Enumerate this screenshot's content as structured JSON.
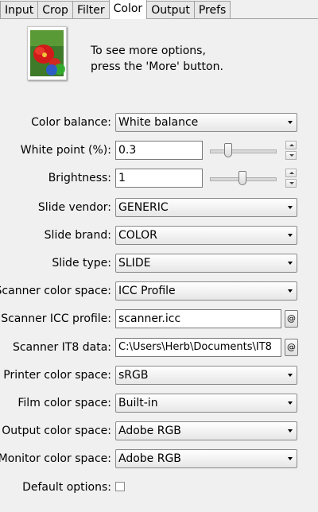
{
  "tabs": [
    "Input",
    "Crop",
    "Filter",
    "Color",
    "Output",
    "Prefs"
  ],
  "active_tab": "Color",
  "info": {
    "line1": "To see more options,",
    "line2": "press the 'More' button."
  },
  "fields": {
    "color_balance": {
      "label": "Color balance:",
      "value": "White balance"
    },
    "white_point": {
      "label": "White point (%):",
      "value": "0.3",
      "slider_fraction": 0.25
    },
    "brightness": {
      "label": "Brightness:",
      "value": "1",
      "slider_fraction": 0.5
    },
    "slide_vendor": {
      "label": "Slide vendor:",
      "value": "GENERIC"
    },
    "slide_brand": {
      "label": "Slide brand:",
      "value": "COLOR"
    },
    "slide_type": {
      "label": "Slide type:",
      "value": "SLIDE"
    },
    "scanner_color_space": {
      "label": "Scanner color space:",
      "value": "ICC Profile"
    },
    "scanner_icc_profile": {
      "label": "Scanner ICC profile:",
      "value": "scanner.icc",
      "button": "@"
    },
    "scanner_it8_data": {
      "label": "Scanner IT8 data:",
      "value": "C:\\Users\\Herb\\Documents\\IT8",
      "button": "@"
    },
    "printer_color_space": {
      "label": "Printer color space:",
      "value": "sRGB"
    },
    "film_color_space": {
      "label": "Film color space:",
      "value": "Built-in"
    },
    "output_color_space": {
      "label": "Output color space:",
      "value": "Adobe RGB"
    },
    "monitor_color_space": {
      "label": "Monitor color space:",
      "value": "Adobe RGB"
    },
    "default_options": {
      "label": "Default options:",
      "checked": false
    }
  },
  "colors": {
    "background": "#f0f0f0",
    "tab_active": "#ffffff"
  }
}
